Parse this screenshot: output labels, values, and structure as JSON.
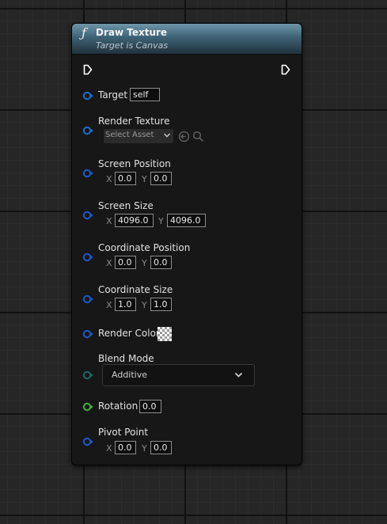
{
  "node": {
    "title": "Draw Texture",
    "subtitle": "Target is Canvas",
    "icon": "function-icon"
  },
  "colors": {
    "header": "#4a7184",
    "object_pin": "#1a6fd9",
    "struct_pin": "#1a5ad0",
    "enum_pin": "#1c6a6a",
    "float_pin": "#3fb537",
    "exec_pin": "#ffffff"
  },
  "pins": {
    "target": {
      "label": "Target",
      "value": "self"
    },
    "render_texture": {
      "label": "Render Texture",
      "select_label": "Select Asset"
    },
    "screen_position": {
      "label": "Screen Position",
      "x_label": "X",
      "x": "0.0",
      "y_label": "Y",
      "y": "0.0"
    },
    "screen_size": {
      "label": "Screen Size",
      "x_label": "X",
      "x": "4096.0",
      "y_label": "Y",
      "y": "4096.0"
    },
    "coordinate_position": {
      "label": "Coordinate Position",
      "x_label": "X",
      "x": "0.0",
      "y_label": "Y",
      "y": "0.0"
    },
    "coordinate_size": {
      "label": "Coordinate Size",
      "x_label": "X",
      "x": "1.0",
      "y_label": "Y",
      "y": "1.0"
    },
    "render_color": {
      "label": "Render Color"
    },
    "blend_mode": {
      "label": "Blend Mode",
      "value": "Additive"
    },
    "rotation": {
      "label": "Rotation",
      "value": "0.0"
    },
    "pivot_point": {
      "label": "Pivot Point",
      "x_label": "X",
      "x": "0.0",
      "y_label": "Y",
      "y": "0.0"
    }
  }
}
